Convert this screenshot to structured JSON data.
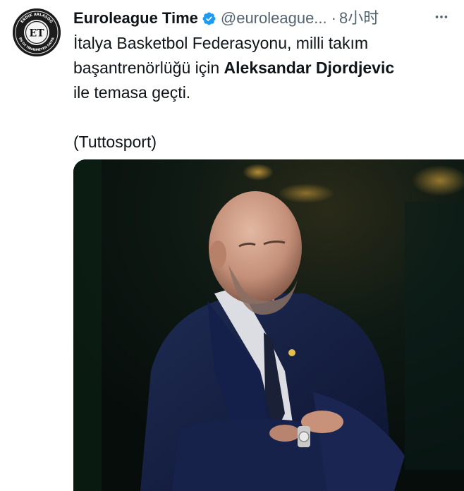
{
  "tweet": {
    "display_name": "Euroleague Time",
    "handle": "@euroleague...",
    "separator": "·",
    "time": "8小时",
    "text": {
      "line1": "İtalya Basketbol Federasyonu, milli takım",
      "line2_plain": "başantrenörlüğü için ",
      "line2_bold": "Aleksandar Djordjevic",
      "line3": "ile temasa geçti.",
      "source": "(Tuttosport)"
    },
    "avatar": {
      "monogram": "ET",
      "ring_text_top": "ERDİK ARLASOĞ",
      "ring_text_bottom": "EN İYİ TİRMEMEYEN SAYFA"
    }
  },
  "icons": {
    "verified": "verified-badge-icon",
    "more": "more-horizontal-icon"
  },
  "colors": {
    "text_primary": "#0f1419",
    "text_secondary": "#536471",
    "verified_blue": "#1d9bf0",
    "background": "#ffffff"
  }
}
